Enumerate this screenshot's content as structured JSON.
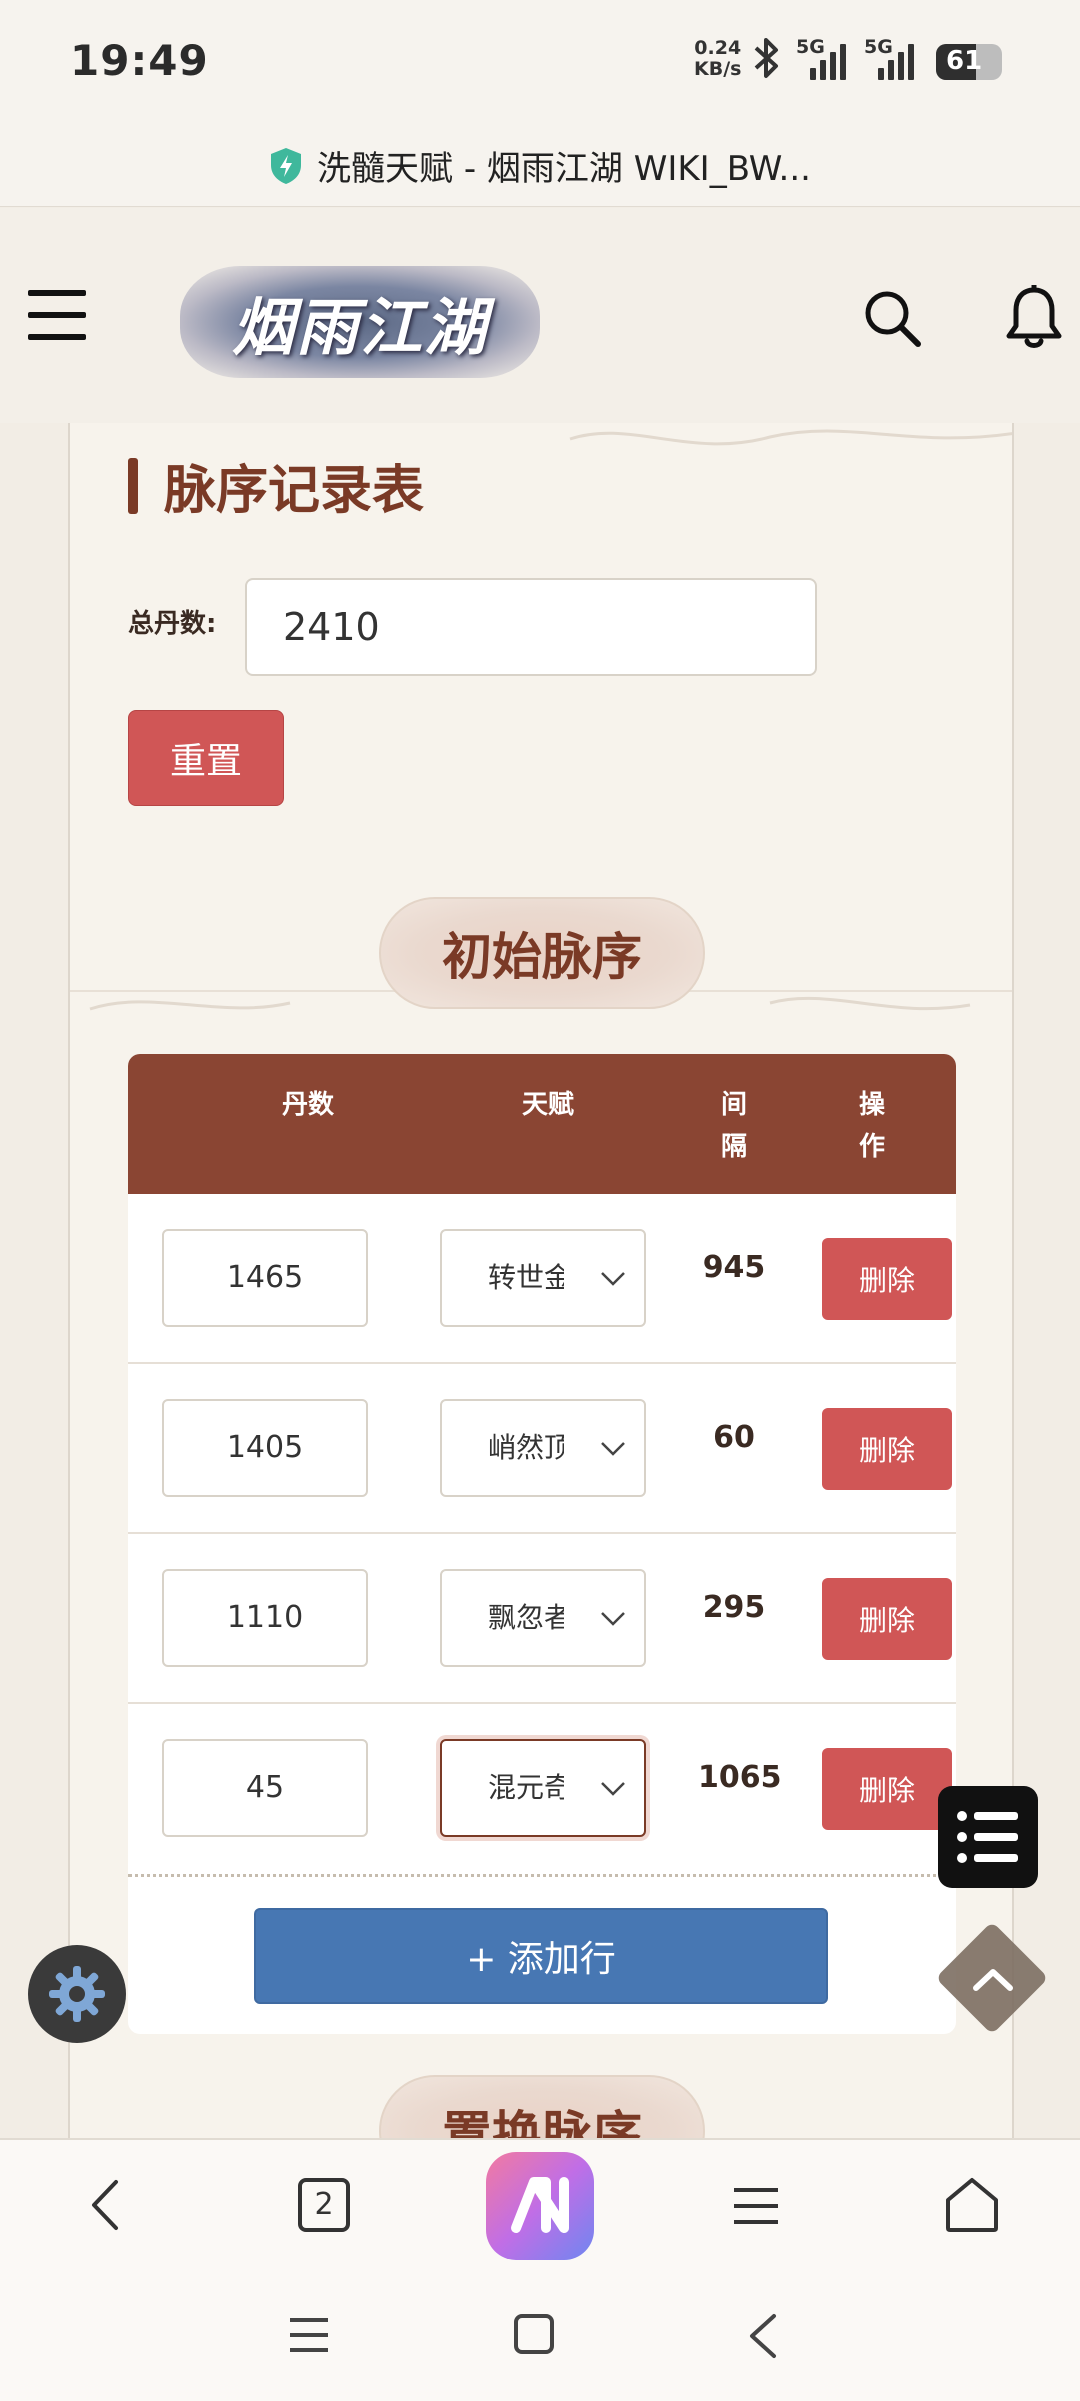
{
  "status_bar": {
    "time": "19:49",
    "net_speed_value": "0.24",
    "net_speed_unit": "KB/s",
    "signal_1_label": "5G",
    "signal_2_label": "5G",
    "battery_percent": "61",
    "battery_level": 0.61
  },
  "browser": {
    "page_title": "洗髓天赋 - 烟雨江湖 WIKI_BW...",
    "tab_count": "2"
  },
  "site": {
    "logo_text": "烟雨江湖"
  },
  "main": {
    "section_title": "脉序记录表",
    "total_label": "总丹数:",
    "total_value": "2410",
    "reset_label": "重置",
    "initial_heading": "初始脉序",
    "next_heading": "置换脉序",
    "add_row_label": "+ 添加行"
  },
  "table": {
    "headers": {
      "dan": "丹数",
      "talent": "天赋",
      "gap_1": "间",
      "gap_2": "隔",
      "op_1": "操",
      "op_2": "作"
    },
    "rows": [
      {
        "dan": "1465",
        "talent": "转世金",
        "gap": "945",
        "action": "删除"
      },
      {
        "dan": "1405",
        "talent": "峭然顶",
        "gap": "60",
        "action": "删除"
      },
      {
        "dan": "1110",
        "talent": "飘忽者",
        "gap": "295",
        "action": "删除"
      },
      {
        "dan": "45",
        "talent": "混元奇",
        "gap": "1065",
        "action": "删除"
      }
    ]
  },
  "colors": {
    "accent": "#7a3a26",
    "table_header": "#8a4533",
    "danger": "#d05656",
    "primary": "#4777b3"
  }
}
